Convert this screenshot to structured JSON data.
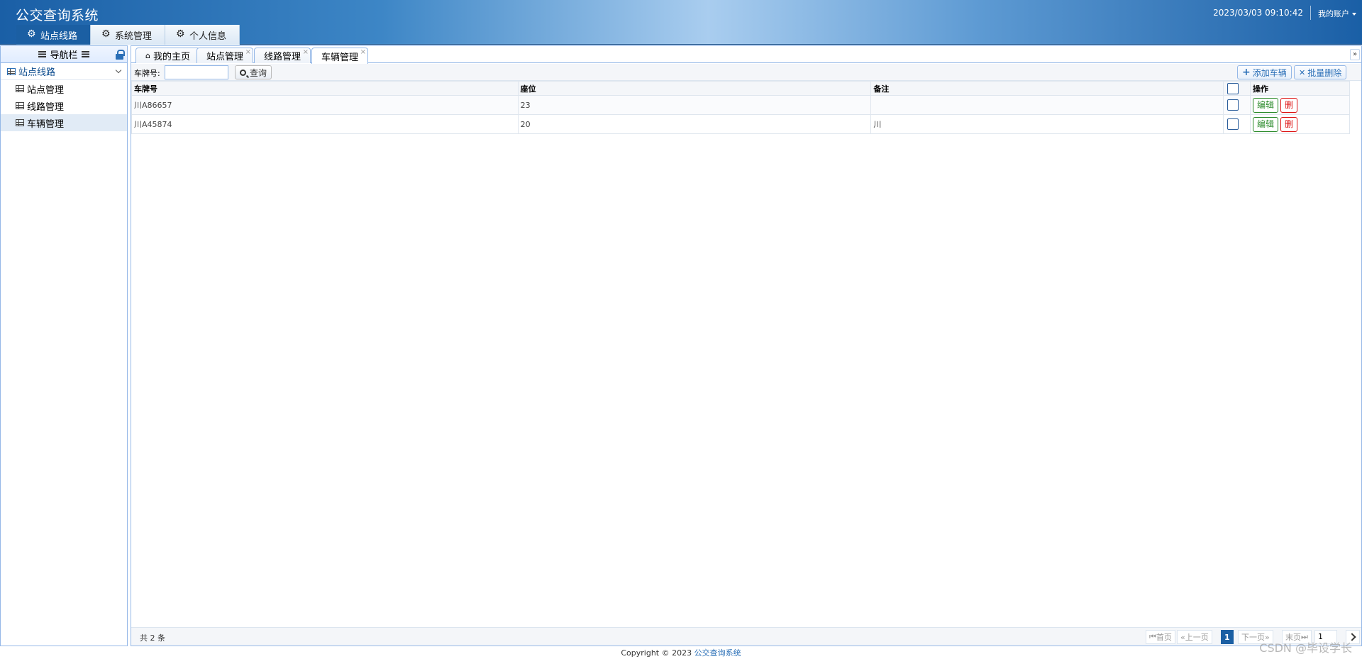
{
  "header": {
    "title": "公交查询系统",
    "datetime": "2023/03/03 09:10:42",
    "account": "我的账户",
    "tabs": [
      {
        "label": "站点线路",
        "active": true
      },
      {
        "label": "系统管理",
        "active": false
      },
      {
        "label": "个人信息",
        "active": false
      }
    ]
  },
  "sidebar": {
    "title": "导航栏",
    "group": "站点线路",
    "items": [
      {
        "label": "站点管理"
      },
      {
        "label": "线路管理"
      },
      {
        "label": "车辆管理"
      }
    ]
  },
  "tabs": [
    {
      "label": "我的主页",
      "closable": false
    },
    {
      "label": "站点管理",
      "closable": true
    },
    {
      "label": "线路管理",
      "closable": true
    },
    {
      "label": "车辆管理",
      "closable": true,
      "active": true
    }
  ],
  "toolbar": {
    "plate_label": "车牌号:",
    "plate_value": "",
    "search_label": "查询",
    "add_label": "添加车辆",
    "batch_delete_label": "批量删除"
  },
  "grid": {
    "columns": [
      "车牌号",
      "座位",
      "备注",
      "",
      "操作"
    ],
    "rows": [
      {
        "plate": "川A86657",
        "seats": "23",
        "note": ""
      },
      {
        "plate": "川A45874",
        "seats": "20",
        "note": "川"
      }
    ],
    "edit_label": "编辑",
    "delete_label": "删"
  },
  "pager": {
    "total": "共 2 条",
    "first": "首页",
    "prev": "上一页",
    "current": "1",
    "next": "下一页",
    "last": "末页",
    "page_input": "1"
  },
  "footer": {
    "copyright": "Copyright © 2023",
    "link": "公交查询系统"
  },
  "watermark": "CSDN @毕设学长",
  "colors": {
    "primary": "#1b5fa3",
    "border": "#95b8e7",
    "edit": "#2a8a2a",
    "delete": "#dd1111"
  }
}
